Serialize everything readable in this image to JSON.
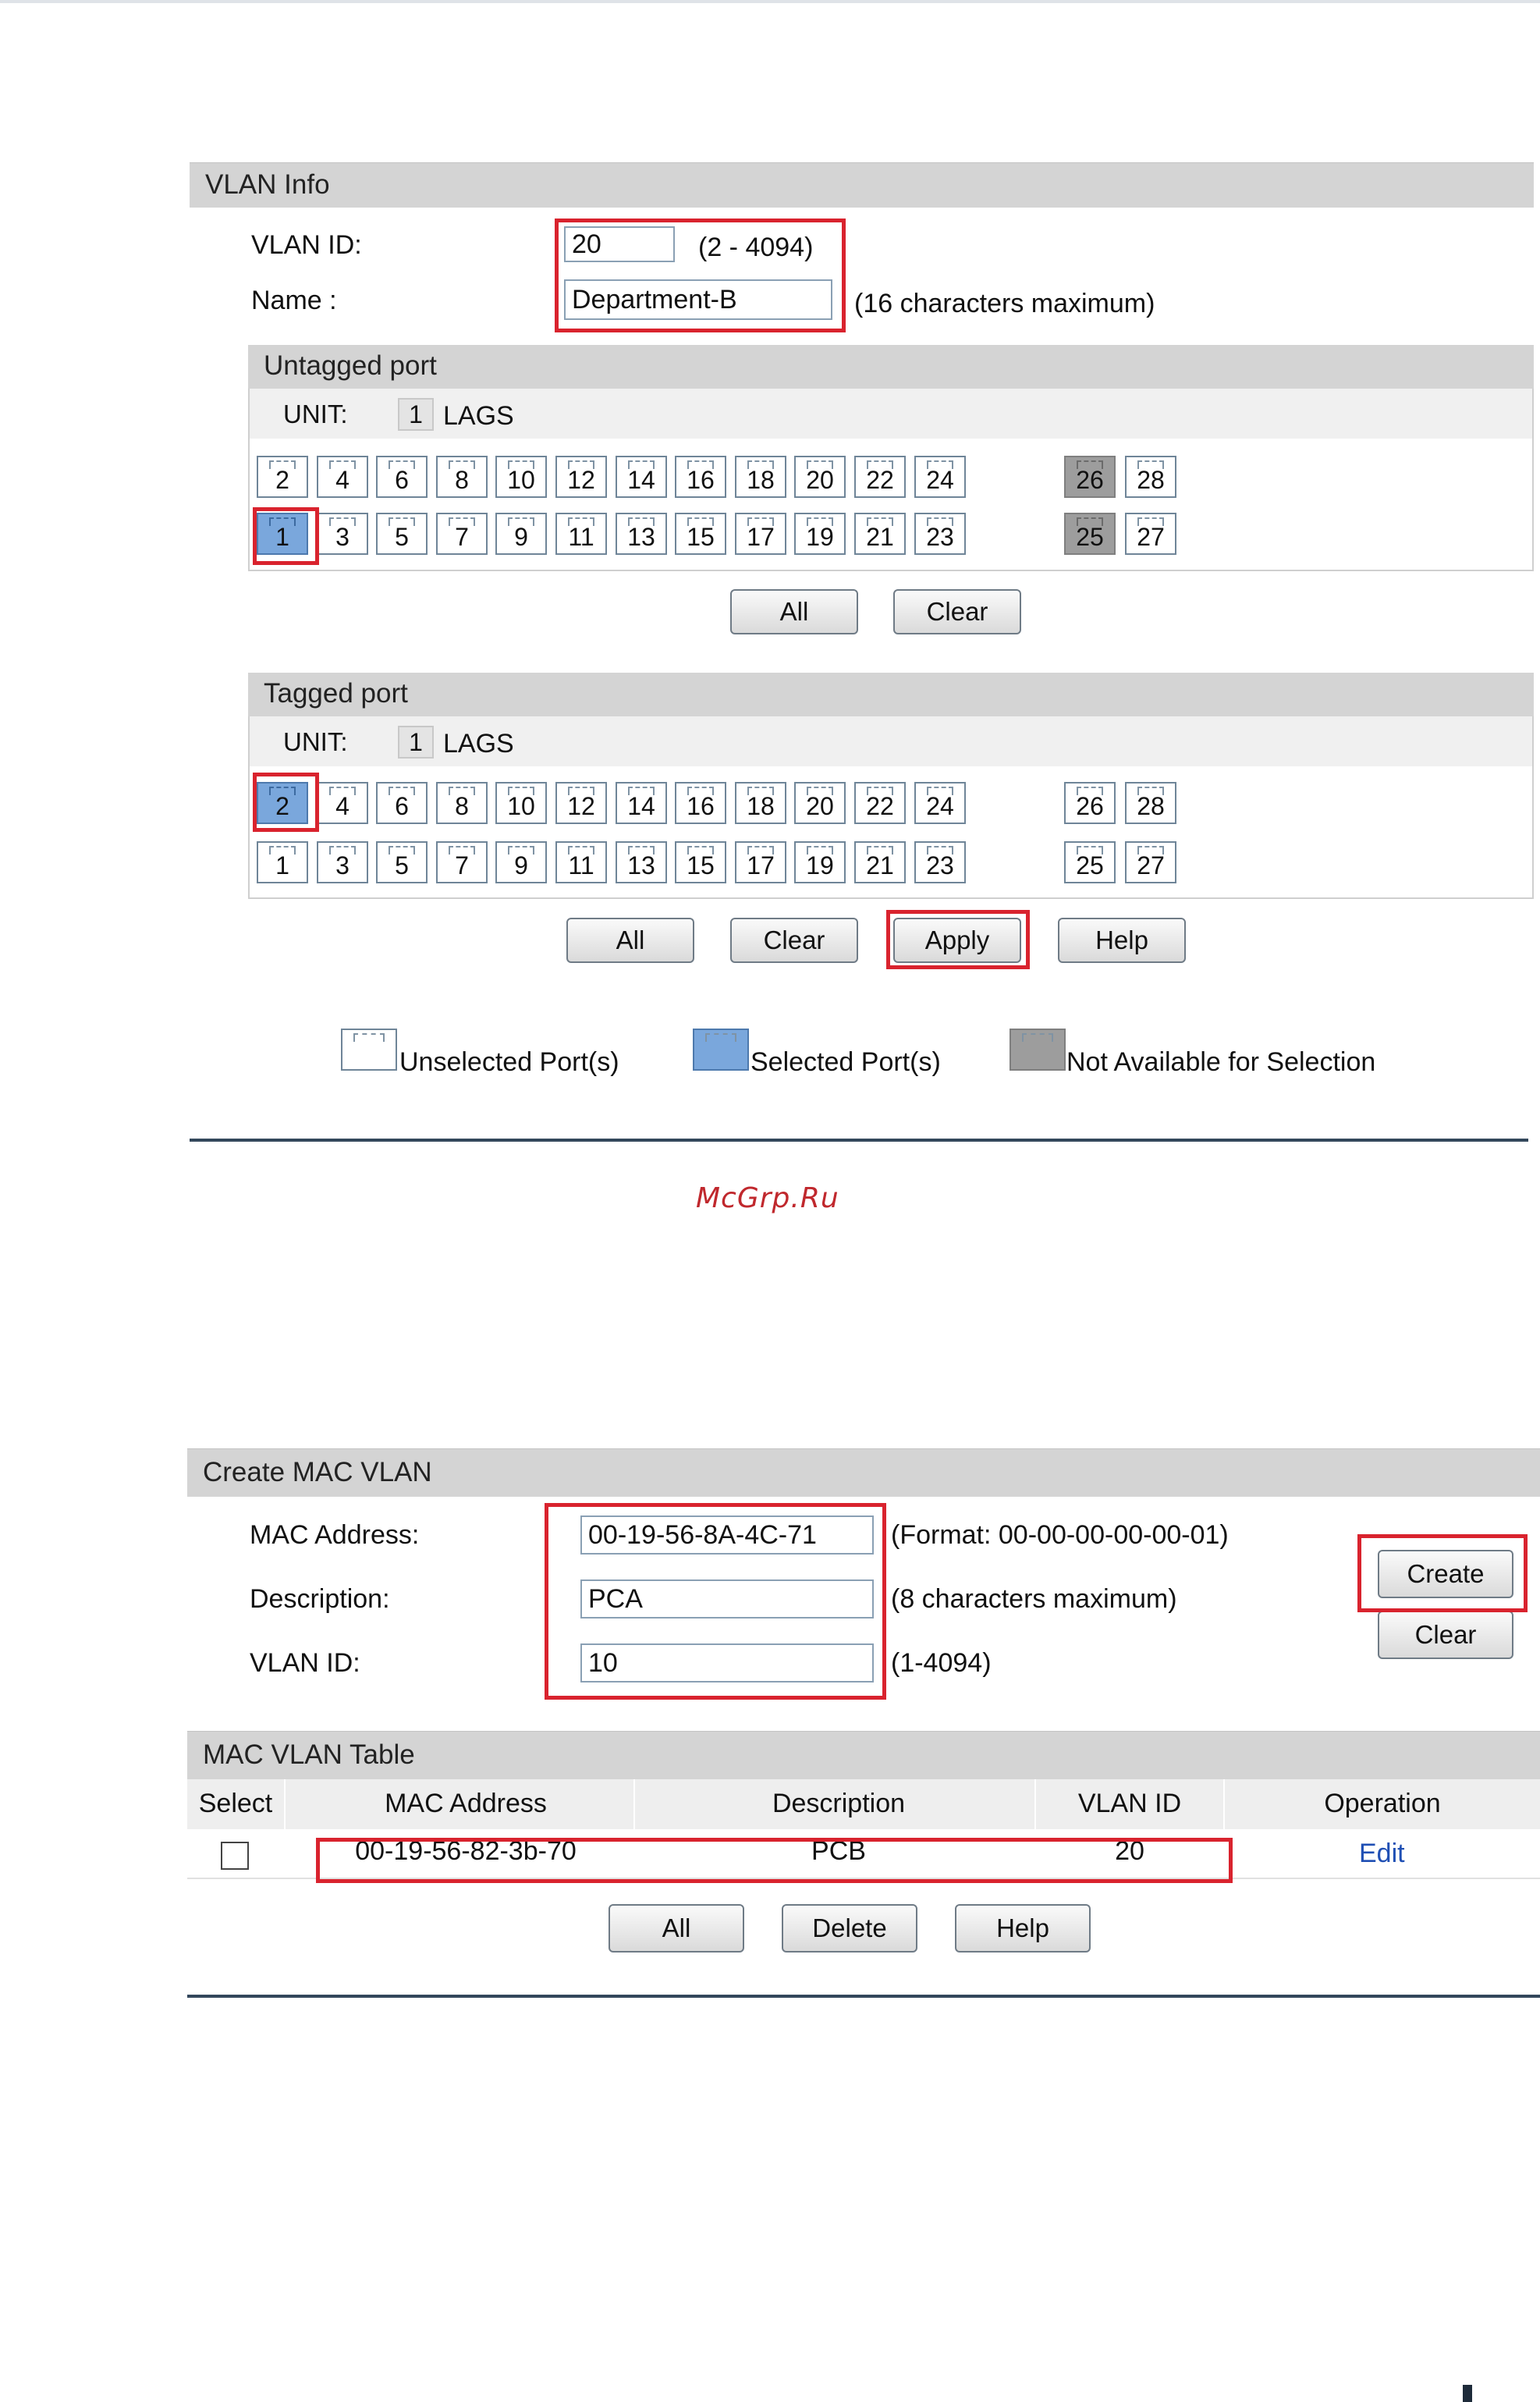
{
  "vlan_info": {
    "header": "VLAN Info",
    "vlan_id_label": "VLAN ID:",
    "vlan_id_value": "20",
    "vlan_id_range": "(2 - 4094)",
    "name_label": "Name :",
    "name_value": "Department-B",
    "name_note": "(16 characters maximum)"
  },
  "untagged": {
    "header": "Untagged port",
    "unit_label": "UNIT:",
    "unit_value": "1",
    "lags_label": "LAGS",
    "top_ports": [
      "2",
      "4",
      "6",
      "8",
      "10",
      "12",
      "14",
      "16",
      "18",
      "20",
      "22",
      "24"
    ],
    "bottom_ports": [
      "1",
      "3",
      "5",
      "7",
      "9",
      "11",
      "13",
      "15",
      "17",
      "19",
      "21",
      "23"
    ],
    "extra_top": [
      "26",
      "28"
    ],
    "extra_bottom": [
      "25",
      "27"
    ],
    "selected": [
      "1"
    ],
    "not_available": [
      "25",
      "26"
    ],
    "all_button": "All",
    "clear_button": "Clear"
  },
  "tagged": {
    "header": "Tagged port",
    "unit_label": "UNIT:",
    "unit_value": "1",
    "lags_label": "LAGS",
    "top_ports": [
      "2",
      "4",
      "6",
      "8",
      "10",
      "12",
      "14",
      "16",
      "18",
      "20",
      "22",
      "24"
    ],
    "bottom_ports": [
      "1",
      "3",
      "5",
      "7",
      "9",
      "11",
      "13",
      "15",
      "17",
      "19",
      "21",
      "23"
    ],
    "extra_top": [
      "26",
      "28"
    ],
    "extra_bottom": [
      "25",
      "27"
    ],
    "selected": [
      "2"
    ],
    "not_available": [],
    "all_button": "All",
    "clear_button": "Clear",
    "apply_button": "Apply",
    "help_button": "Help"
  },
  "legend": {
    "unselected": "Unselected Port(s)",
    "selected": "Selected Port(s)",
    "not_available": "Not Available for Selection"
  },
  "watermark": "McGrp.Ru",
  "create_mac_vlan": {
    "header": "Create MAC VLAN",
    "mac_label": "MAC Address:",
    "mac_value": "00-19-56-8A-4C-71",
    "mac_note": "(Format: 00-00-00-00-00-01)",
    "desc_label": "Description:",
    "desc_value": "PCA",
    "desc_note": "(8 characters maximum)",
    "vlan_label": "VLAN ID:",
    "vlan_value": "10",
    "vlan_note": "(1-4094)",
    "create_button": "Create",
    "clear_button": "Clear"
  },
  "mac_vlan_table": {
    "header": "MAC VLAN Table",
    "columns": [
      "Select",
      "MAC Address",
      "Description",
      "VLAN ID",
      "Operation"
    ],
    "rows": [
      {
        "mac": "00-19-56-82-3b-70",
        "description": "PCB",
        "vlan_id": "20",
        "operation": "Edit"
      }
    ],
    "all_button": "All",
    "delete_button": "Delete",
    "help_button": "Help"
  },
  "colors": {
    "highlight": "#d9232e",
    "selected_port": "#7aa7dc",
    "unavailable_port": "#9d9d9d",
    "header_bg": "#d4d4d4",
    "link": "#1f4fb4"
  }
}
